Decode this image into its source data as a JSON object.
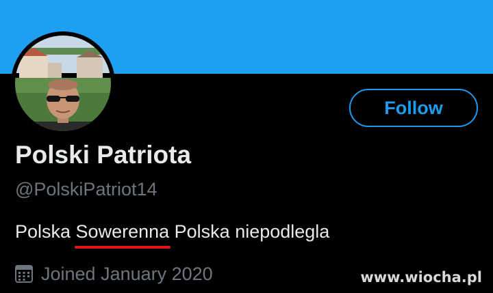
{
  "profile": {
    "name": "Polski Patriota",
    "handle": "@PolskiPatriot14",
    "bio_before": "Polska ",
    "bio_highlight": "Sowerenna",
    "bio_after": " Polska niepodlegla",
    "joined": "Joined January 2020",
    "follow_label": "Follow"
  },
  "icons": {
    "calendar": "calendar-icon"
  },
  "watermark": "www.wiocha.pl",
  "colors": {
    "banner": "#1d9ff2",
    "accent": "#1d9bf0",
    "background": "#000000",
    "primary_text": "#e7e9ea",
    "secondary_text": "#6e767d",
    "highlight_underline": "#e0141e"
  }
}
